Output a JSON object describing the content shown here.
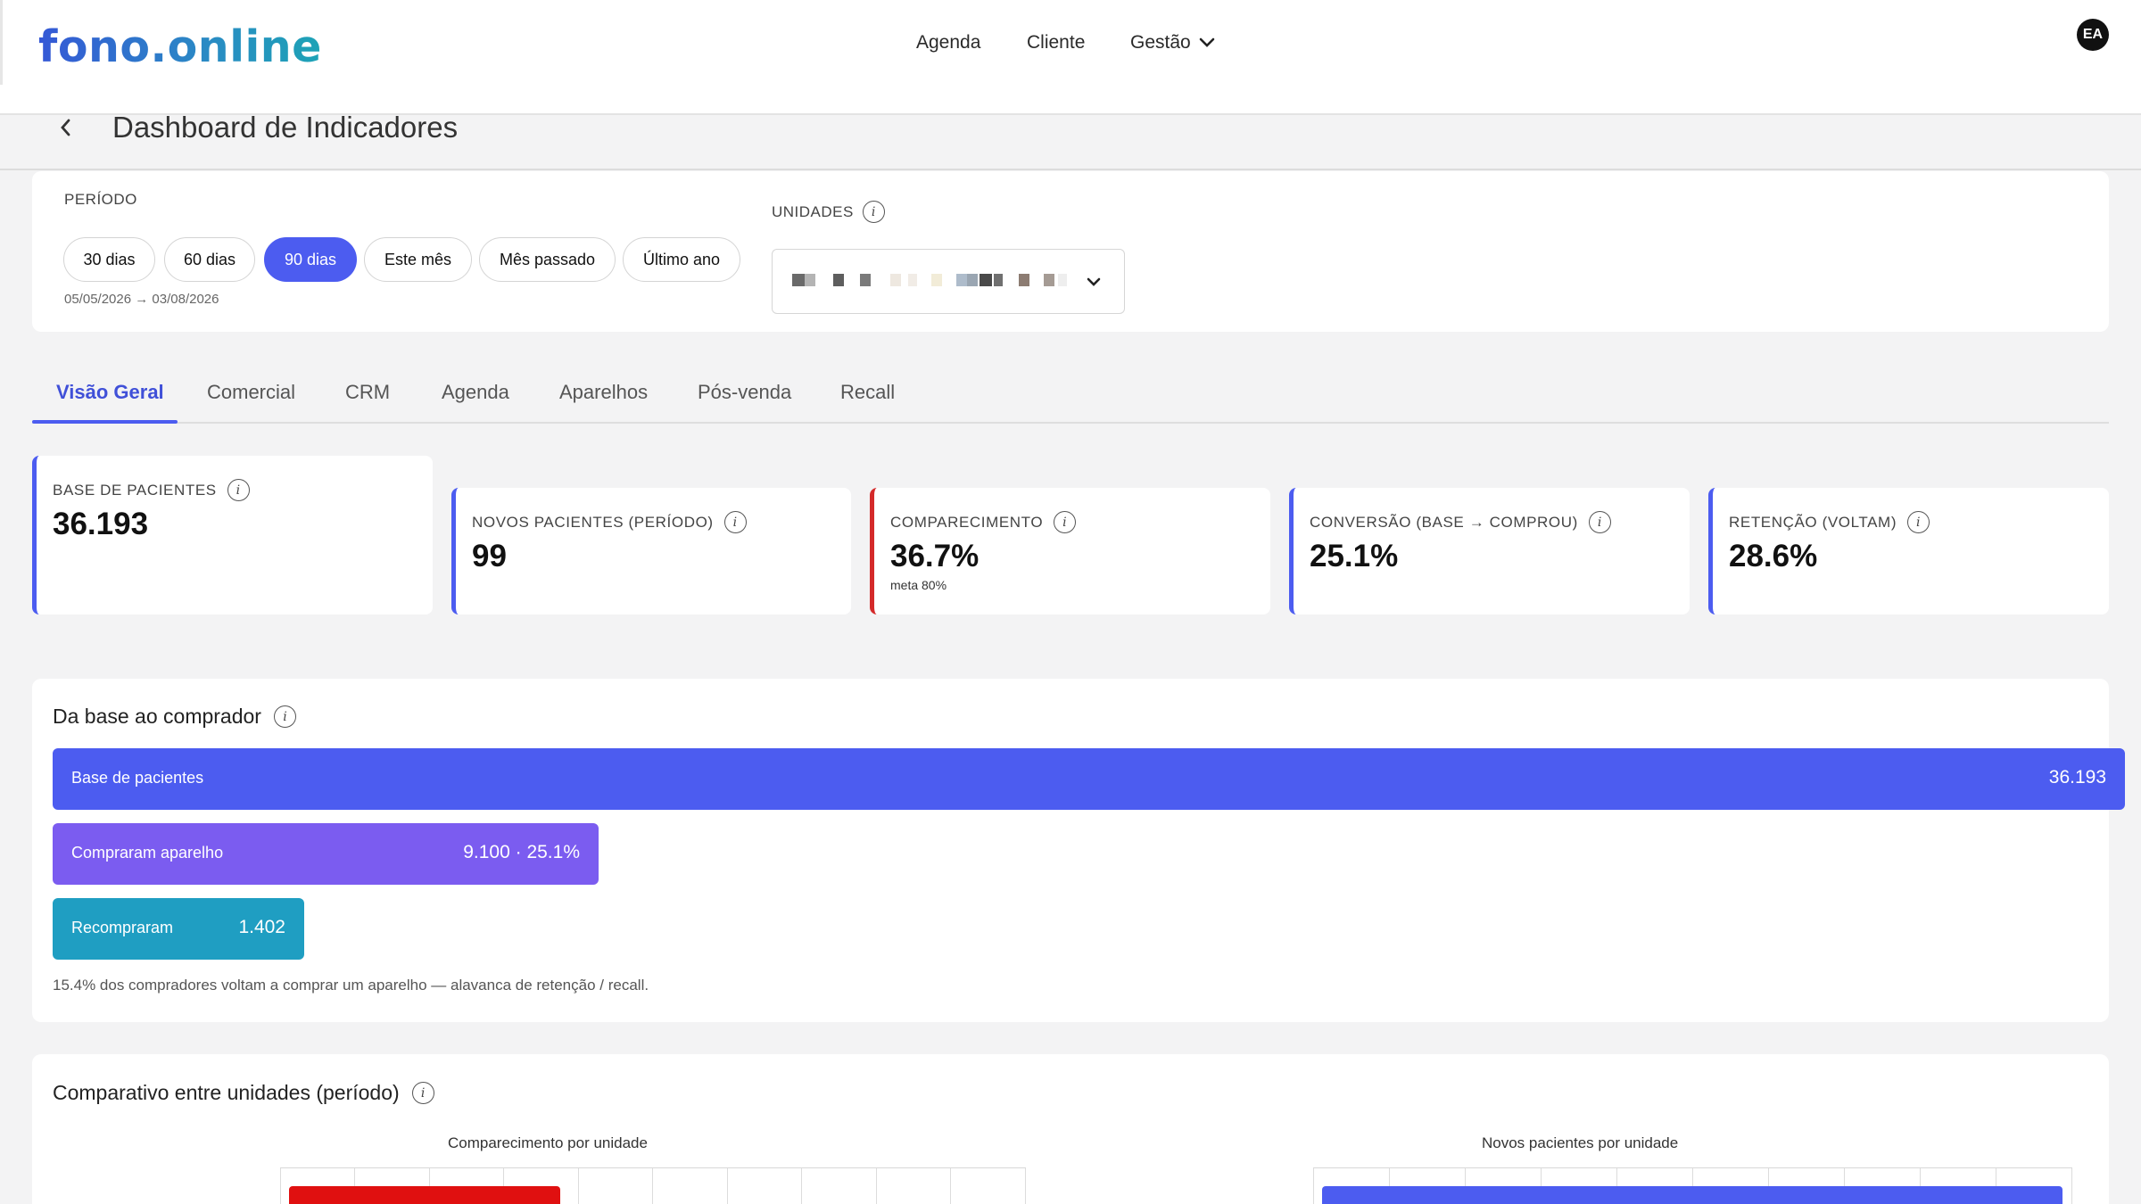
{
  "header": {
    "logo": "fono.online",
    "nav": [
      "Agenda",
      "Cliente",
      "Gestão"
    ],
    "avatar": "EA"
  },
  "page": {
    "title": "Dashboard de Indicadores"
  },
  "filters": {
    "period_label": "PERÍODO",
    "periods": [
      "30 dias",
      "60 dias",
      "90 dias",
      "Este mês",
      "Mês passado",
      "Último ano"
    ],
    "active_period": "90 dias",
    "date_range": "05/05/2026 → 03/08/2026",
    "units_label": "UNIDADES"
  },
  "tabs": [
    "Visão Geral",
    "Comercial",
    "CRM",
    "Agenda",
    "Aparelhos",
    "Pós-venda",
    "Recall"
  ],
  "active_tab": "Visão Geral",
  "kpis": [
    {
      "label": "BASE DE PACIENTES",
      "value": "36.193",
      "sub": ""
    },
    {
      "label": "NOVOS PACIENTES (PERÍODO)",
      "value": "99",
      "sub": ""
    },
    {
      "label": "COMPARECIMENTO",
      "value": "36.7%",
      "sub": "meta 80%"
    },
    {
      "label": "CONVERSÃO (BASE → COMPROU)",
      "value": "25.1%",
      "sub": ""
    },
    {
      "label": "RETENÇÃO (VOLTAM)",
      "value": "28.6%",
      "sub": ""
    }
  ],
  "funnel": {
    "title": "Da base ao comprador",
    "bars": [
      {
        "label": "Base de pacientes",
        "value": "36.193",
        "color": "#4c5cf0"
      },
      {
        "label": "Compraram aparelho",
        "value": "9.100 · 25.1%",
        "color": "#7b5cf0"
      },
      {
        "label": "Recompraram",
        "value": "1.402",
        "color": "#1f9ec2"
      }
    ],
    "note": "15.4% dos compradores voltam a comprar um aparelho — alavanca de retenção / recall."
  },
  "comparison": {
    "title": "Comparativo entre unidades (período)",
    "charts": [
      {
        "title": "Comparecimento por unidade",
        "bar_color": "#e01010"
      },
      {
        "title": "Novos pacientes por unidade",
        "bar_color": "#4c5cf0"
      }
    ]
  },
  "colors": {
    "accent": "#4c5cf0",
    "alert": "#d42a2a"
  }
}
